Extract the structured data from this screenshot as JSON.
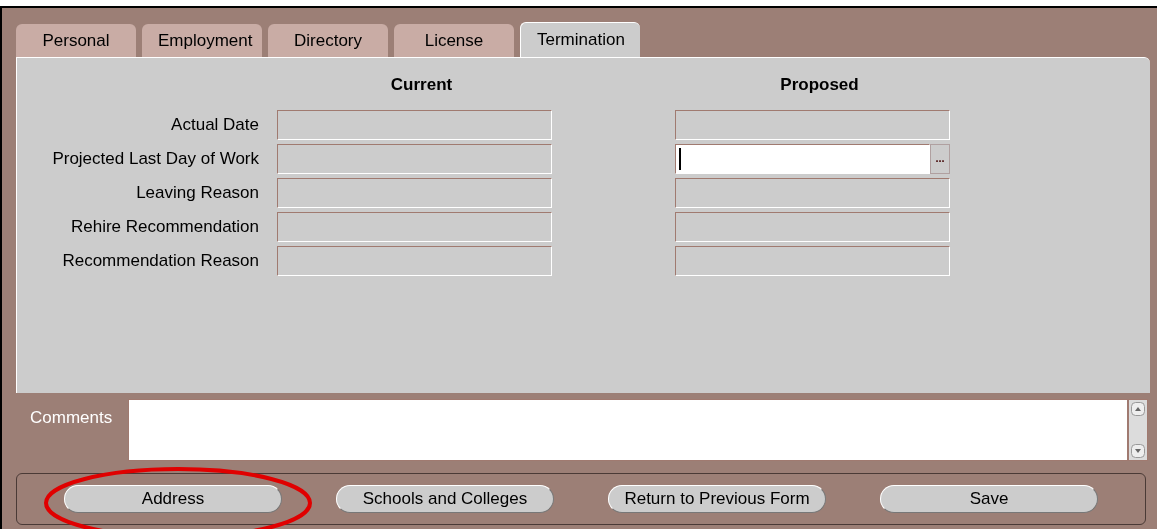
{
  "tabs": [
    {
      "label": "Personal",
      "selected": false
    },
    {
      "label": "Employment",
      "selected": false
    },
    {
      "label": "Directory",
      "selected": false
    },
    {
      "label": "License",
      "selected": false
    },
    {
      "label": "Termination",
      "selected": true
    }
  ],
  "columns": [
    "Current",
    "Proposed"
  ],
  "rows": [
    {
      "label": "Actual Date",
      "proposed": {
        "focused": false
      }
    },
    {
      "label": "Projected Last Day of Work",
      "proposed": {
        "focused": true,
        "lov": "..."
      }
    },
    {
      "label": "Leaving Reason",
      "proposed": {
        "focused": false
      }
    },
    {
      "label": "Rehire Recommendation",
      "proposed": {
        "focused": false
      }
    },
    {
      "label": "Recommendation Reason",
      "proposed": {
        "focused": false
      }
    }
  ],
  "comments": {
    "label": "Comments"
  },
  "buttons": [
    {
      "label": "Address",
      "highlighted": true
    },
    {
      "label": "Schools and Colleges",
      "highlighted": false
    },
    {
      "label": "Return to Previous Form",
      "highlighted": false
    },
    {
      "label": "Save",
      "highlighted": false
    }
  ]
}
